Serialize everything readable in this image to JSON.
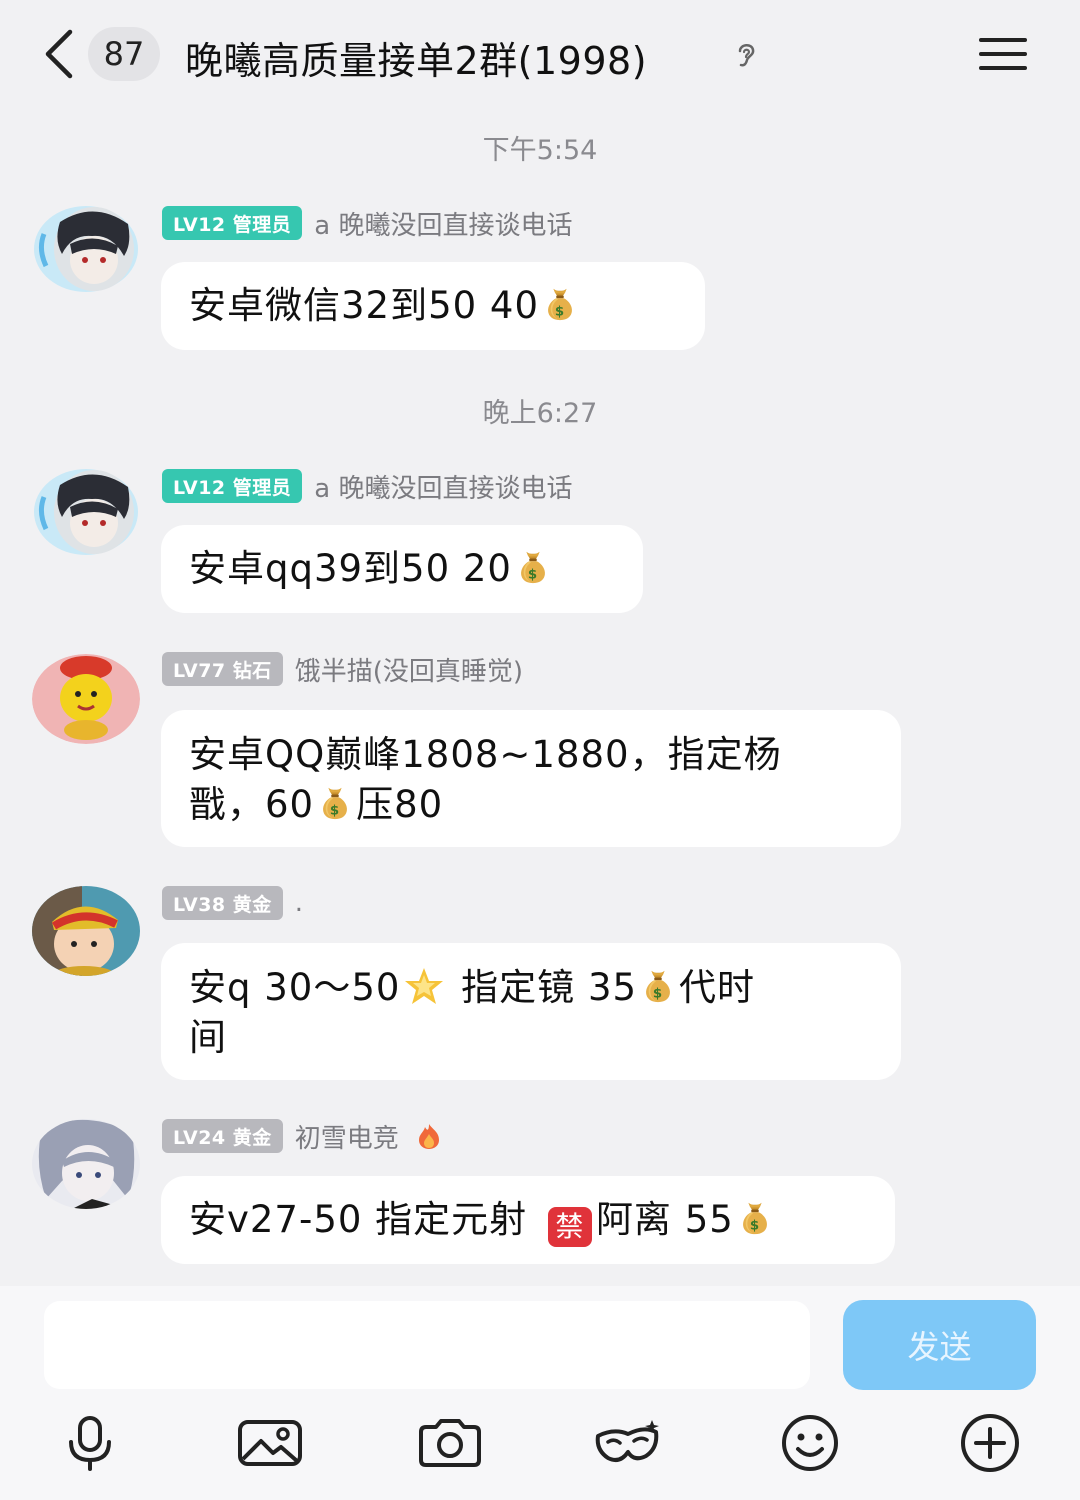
{
  "header": {
    "unread_count": "87",
    "title": "晚曦高质量接单2群(1998)",
    "icons": [
      "back-icon",
      "question-ear-icon",
      "menu-icon"
    ]
  },
  "timestamps": [
    "下午5:54",
    "晚上6:27"
  ],
  "messages": [
    {
      "level": "LV12 管理员",
      "sender": "a 晚曦没回直接谈电话",
      "text_parts": [
        "安卓微信32到50  40"
      ],
      "text_full": "安卓微信32到50  40💰"
    },
    {
      "level": "LV12 管理员",
      "sender": "a 晚曦没回直接谈电话",
      "text_full": "安卓qq39到50 20💰"
    },
    {
      "level": "LV77 钻石",
      "sender": "饿半描(没回真睡觉)",
      "line1": "安卓QQ巅峰1808~1880，指定杨",
      "line2_a": "戬，60",
      "line2_b": "压80"
    },
    {
      "level": "LV38 黄金",
      "sender": ".",
      "line1_a": "安q 30～50",
      "line1_b": " 指定镜 35",
      "line1_c": "代时",
      "line2": "间"
    },
    {
      "level": "LV24 黄金",
      "sender": "初雪电竞",
      "part_a": "安v27-50 指定元射 ",
      "ban_char": "禁",
      "part_b": "阿离  55"
    }
  ],
  "texts": {
    "m1": "安卓微信32到50  40",
    "m2": "安卓qq39到50 20"
  },
  "input": {
    "placeholder": "",
    "send_label": "发送"
  },
  "toolbar": [
    "microphone-icon",
    "image-icon",
    "camera-icon",
    "mask-icon",
    "emoji-icon",
    "plus-icon"
  ],
  "colors": {
    "admin_badge": "#36c7b0",
    "normal_badge": "#b8b8bd",
    "send_button": "#7ec8f7",
    "background": "#f1f1f3"
  }
}
